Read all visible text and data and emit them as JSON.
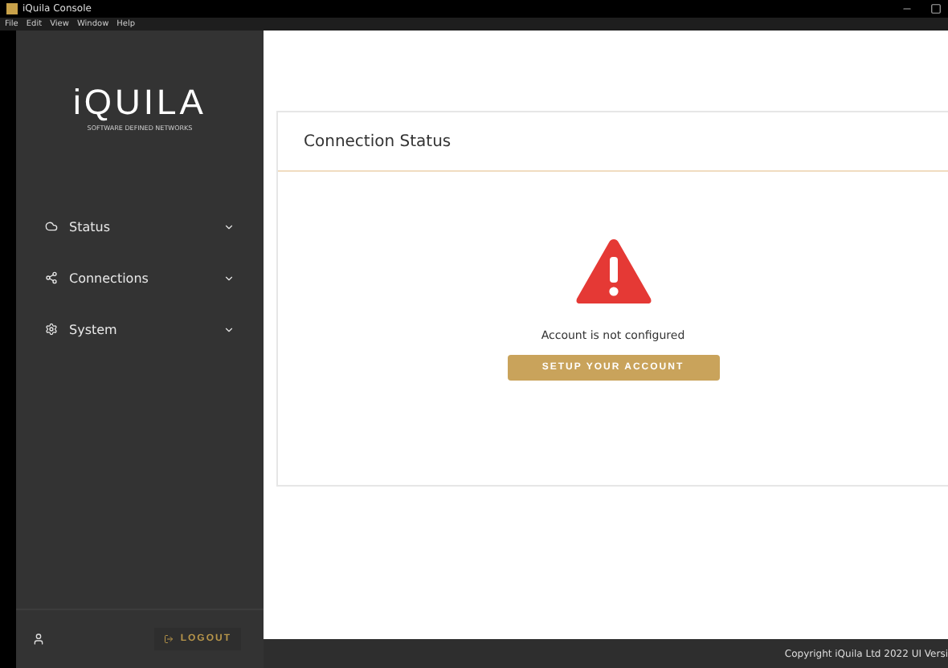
{
  "window": {
    "title": "iQuila Console"
  },
  "menu": [
    "File",
    "Edit",
    "View",
    "Window",
    "Help"
  ],
  "logo": {
    "name": "iQUILA",
    "tagline": "SOFTWARE DEFINED NETWORKS"
  },
  "sidebar": {
    "items": [
      {
        "kind": "cloud",
        "label": "Status",
        "expanded": false
      },
      {
        "kind": "share",
        "label": "Connections",
        "expanded": false
      },
      {
        "kind": "gear",
        "label": "System",
        "expanded": false
      }
    ],
    "logout": "LOGOUT"
  },
  "card": {
    "title": "Connection Status",
    "message": "Account is not configured",
    "button": "SETUP YOUR ACCOUNT"
  },
  "footer": "Copyright iQuila Ltd 2022 UI Versi"
}
